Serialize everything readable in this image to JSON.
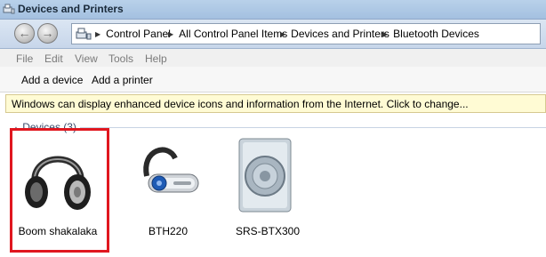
{
  "window": {
    "title": "Devices and Printers"
  },
  "navigation": {
    "breadcrumbs": [
      "Control Panel",
      "All Control Panel Items",
      "Devices and Printers",
      "Bluetooth Devices"
    ]
  },
  "menu": [
    "File",
    "Edit",
    "View",
    "Tools",
    "Help"
  ],
  "commands": {
    "add_device": "Add a device",
    "add_printer": "Add a printer"
  },
  "infobar": {
    "text": "Windows can display enhanced device icons and information from the Internet. Click to change..."
  },
  "group": {
    "label": "Devices (3)"
  },
  "devices": [
    {
      "name": "Boom shakalaka",
      "icon": "headphones-icon",
      "selected": true
    },
    {
      "name": "BTH220",
      "icon": "bluetooth-headset-icon"
    },
    {
      "name": "SRS-BTX300",
      "icon": "speaker-icon"
    }
  ],
  "colors": {
    "highlight": "#e0171f",
    "infobar": "#fffbd4"
  }
}
